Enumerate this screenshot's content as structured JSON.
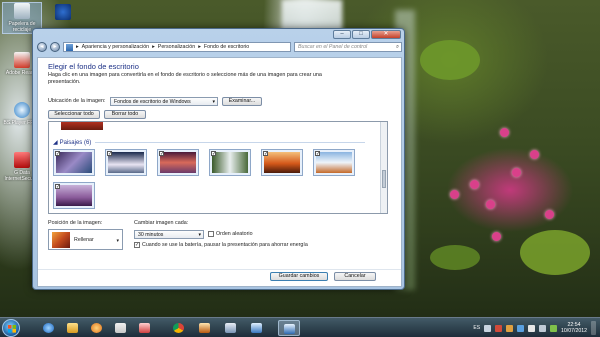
{
  "desktop": {
    "icons": [
      {
        "label": "Papelera de reciclaje",
        "top": 0
      },
      {
        "label": "",
        "top": 0
      },
      {
        "label": "Adobe Reader",
        "top": 0
      },
      {
        "label": "BS.Player FREE",
        "top": 0
      },
      {
        "label": "G Data InternetSecurity",
        "top": 0
      }
    ]
  },
  "window": {
    "controls": {
      "minimize": "–",
      "maximize": "□",
      "close": "✕"
    },
    "address": {
      "crumbs": [
        "Apariencia y personalización",
        "Personalización",
        "Fondo de escritorio"
      ],
      "sep": "▸"
    },
    "search_placeholder": "Buscar en el Panel de control",
    "title": "Elegir el fondo de escritorio",
    "description": "Haga clic en una imagen para convertirla en el fondo de escritorio o seleccione más de una imagen para crear una presentación.",
    "location_label": "Ubicación de la imagen:",
    "location_value": "Fondos de escritorio de Windows",
    "browse_button": "Examinar...",
    "select_all_button": "Seleccionar todo",
    "clear_all_button": "Borrar todo",
    "group_label": "Paisajes (6)",
    "position_label": "Posición de la imagen:",
    "position_value": "Rellenar",
    "change_label": "Cambiar imagen cada:",
    "interval_value": "30 minutos",
    "shuffle_label": "Orden aleatorio",
    "battery_label": "Cuando se use la batería, pausar la presentación para ahorrar energía",
    "save_button": "Guardar cambios",
    "cancel_button": "Cancelar"
  },
  "taskbar": {
    "language": "ES",
    "time": "22:54",
    "date": "10/07/2012"
  },
  "colors": {
    "title": "#1e3287",
    "window_frame": "#a8c4e2",
    "accent": "#2e69b0"
  }
}
